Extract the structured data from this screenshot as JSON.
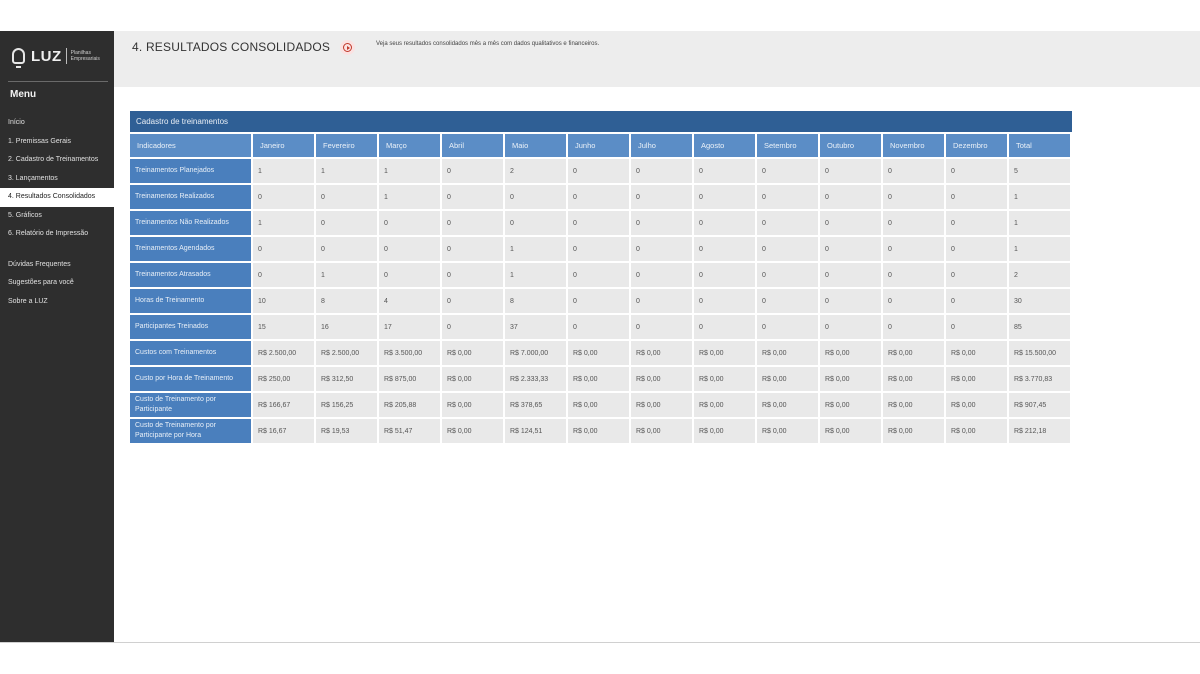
{
  "app": {
    "logo_text": "LUZ",
    "logo_sub_line1": "Planilhas",
    "logo_sub_line2": "Empresariais"
  },
  "sidebar": {
    "menu_title": "Menu",
    "items": [
      {
        "label": "Início",
        "active": false
      },
      {
        "label": "1. Premissas Gerais",
        "active": false
      },
      {
        "label": "2. Cadastro de Treinamentos",
        "active": false
      },
      {
        "label": "3. Lançamentos",
        "active": false
      },
      {
        "label": "4. Resultados Consolidados",
        "active": true
      },
      {
        "label": "5. Gráficos",
        "active": false
      },
      {
        "label": "6. Relatório de Impressão",
        "active": false
      }
    ],
    "extra_items": [
      {
        "label": "Dúvidas Frequentes"
      },
      {
        "label": "Sugestões para você"
      },
      {
        "label": "Sobre a LUZ"
      }
    ]
  },
  "header": {
    "title": "4. RESULTADOS CONSOLIDADOS",
    "subtitle": "Veja seus resultados consolidados mês a mês com dados qualitativos e financeiros."
  },
  "table": {
    "caption": "Cadastro de treinamentos",
    "columns": [
      "Indicadores",
      "Janeiro",
      "Fevereiro",
      "Março",
      "Abril",
      "Maio",
      "Junho",
      "Julho",
      "Agosto",
      "Setembro",
      "Outubro",
      "Novembro",
      "Dezembro",
      "Total"
    ],
    "rows": [
      {
        "label": "Treinamentos Planejados",
        "values": [
          "1",
          "1",
          "1",
          "0",
          "2",
          "0",
          "0",
          "0",
          "0",
          "0",
          "0",
          "0",
          "5"
        ]
      },
      {
        "label": "Treinamentos Realizados",
        "values": [
          "0",
          "0",
          "1",
          "0",
          "0",
          "0",
          "0",
          "0",
          "0",
          "0",
          "0",
          "0",
          "1"
        ]
      },
      {
        "label": "Treinamentos Não Realizados",
        "values": [
          "1",
          "0",
          "0",
          "0",
          "0",
          "0",
          "0",
          "0",
          "0",
          "0",
          "0",
          "0",
          "1"
        ]
      },
      {
        "label": "Treinamentos Agendados",
        "values": [
          "0",
          "0",
          "0",
          "0",
          "1",
          "0",
          "0",
          "0",
          "0",
          "0",
          "0",
          "0",
          "1"
        ]
      },
      {
        "label": "Treinamentos Atrasados",
        "values": [
          "0",
          "1",
          "0",
          "0",
          "1",
          "0",
          "0",
          "0",
          "0",
          "0",
          "0",
          "0",
          "2"
        ]
      },
      {
        "label": "Horas de Treinamento",
        "values": [
          "10",
          "8",
          "4",
          "0",
          "8",
          "0",
          "0",
          "0",
          "0",
          "0",
          "0",
          "0",
          "30"
        ]
      },
      {
        "label": "Participantes Treinados",
        "values": [
          "15",
          "16",
          "17",
          "0",
          "37",
          "0",
          "0",
          "0",
          "0",
          "0",
          "0",
          "0",
          "85"
        ]
      },
      {
        "label": "Custos com Treinamentos",
        "values": [
          "R$ 2.500,00",
          "R$ 2.500,00",
          "R$ 3.500,00",
          "R$ 0,00",
          "R$ 7.000,00",
          "R$ 0,00",
          "R$ 0,00",
          "R$ 0,00",
          "R$ 0,00",
          "R$ 0,00",
          "R$ 0,00",
          "R$ 0,00",
          "R$ 15.500,00"
        ]
      },
      {
        "label": "Custo por Hora de Treinamento",
        "values": [
          "R$ 250,00",
          "R$ 312,50",
          "R$ 875,00",
          "R$ 0,00",
          "R$ 2.333,33",
          "R$ 0,00",
          "R$ 0,00",
          "R$ 0,00",
          "R$ 0,00",
          "R$ 0,00",
          "R$ 0,00",
          "R$ 0,00",
          "R$ 3.770,83"
        ]
      },
      {
        "label": "Custo de Treinamento por Participante",
        "values": [
          "R$ 166,67",
          "R$ 156,25",
          "R$ 205,88",
          "R$ 0,00",
          "R$ 378,65",
          "R$ 0,00",
          "R$ 0,00",
          "R$ 0,00",
          "R$ 0,00",
          "R$ 0,00",
          "R$ 0,00",
          "R$ 0,00",
          "R$ 907,45"
        ]
      },
      {
        "label": "Custo de Treinamento por Participante por Hora",
        "values": [
          "R$ 16,67",
          "R$ 19,53",
          "R$ 51,47",
          "R$ 0,00",
          "R$ 124,51",
          "R$ 0,00",
          "R$ 0,00",
          "R$ 0,00",
          "R$ 0,00",
          "R$ 0,00",
          "R$ 0,00",
          "R$ 0,00",
          "R$ 212,18"
        ]
      }
    ]
  },
  "icons": {
    "logo": "lightbulb-icon",
    "play": "play-circle-icon"
  },
  "colors": {
    "sidebar_bg": "#2e2e2e",
    "header_bg": "#ededed",
    "caption_bg": "#2f5f95",
    "column_header_bg": "#5b8dc6",
    "row_header_bg": "#4a7fbd",
    "cell_bg": "#e9e9e9",
    "play_accent": "#c0392b"
  }
}
